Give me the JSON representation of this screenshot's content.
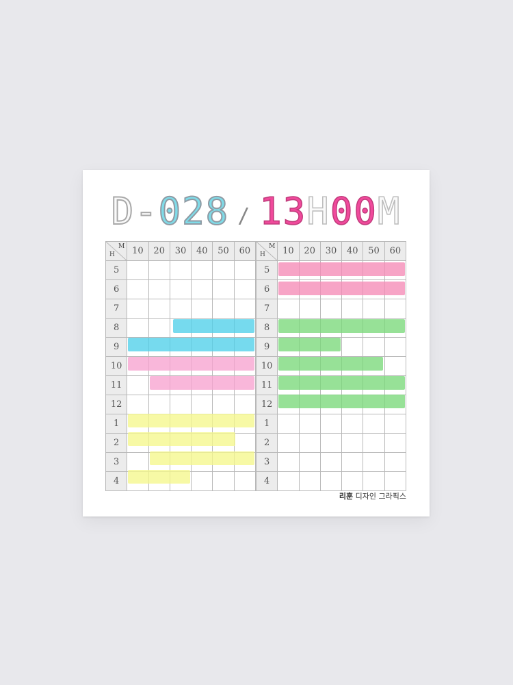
{
  "header": {
    "dday_prefix": "D-",
    "dday_digits": "028",
    "separator": "/",
    "time_hours": "13",
    "time_h_suffix": "H",
    "time_minutes": "00",
    "time_m_suffix": "M"
  },
  "corner": {
    "m_label": "M",
    "h_label": "H"
  },
  "minutes": [
    "10",
    "20",
    "30",
    "40",
    "50",
    "60"
  ],
  "left_hours": [
    "5",
    "6",
    "7",
    "8",
    "9",
    "10",
    "11",
    "12",
    "1",
    "2",
    "3",
    "4"
  ],
  "right_hours": [
    "5",
    "6",
    "7",
    "8",
    "9",
    "10",
    "11",
    "12",
    "1",
    "2",
    "3",
    "4"
  ],
  "colors": {
    "cyan": "#4fd0e9",
    "pink": "#f7a3cf",
    "yellow": "#f5f78c",
    "green": "#7ad97a",
    "hot_pink": "#f58ab6",
    "noon_line": "#e88a8a"
  },
  "highlights": {
    "left": [
      {
        "hour_index": 3,
        "start": 0.35,
        "end": 1.0,
        "color": "cyan"
      },
      {
        "hour_index": 4,
        "start": 0.0,
        "end": 1.0,
        "color": "cyan"
      },
      {
        "hour_index": 5,
        "start": 0.0,
        "end": 1.0,
        "color": "pink"
      },
      {
        "hour_index": 6,
        "start": 0.17,
        "end": 1.0,
        "color": "pink"
      },
      {
        "hour_index": 8,
        "start": 0.0,
        "end": 1.0,
        "color": "yellow"
      },
      {
        "hour_index": 9,
        "start": 0.0,
        "end": 0.85,
        "color": "yellow"
      },
      {
        "hour_index": 10,
        "start": 0.17,
        "end": 1.0,
        "color": "yellow"
      },
      {
        "hour_index": 11,
        "start": 0.0,
        "end": 0.5,
        "color": "yellow"
      }
    ],
    "right": [
      {
        "hour_index": 0,
        "start": 0.0,
        "end": 1.0,
        "color": "hot_pink"
      },
      {
        "hour_index": 1,
        "start": 0.0,
        "end": 1.0,
        "color": "hot_pink"
      },
      {
        "hour_index": 3,
        "start": 0.0,
        "end": 1.0,
        "color": "green"
      },
      {
        "hour_index": 4,
        "start": 0.0,
        "end": 0.5,
        "color": "green"
      },
      {
        "hour_index": 5,
        "start": 0.0,
        "end": 0.83,
        "color": "green"
      },
      {
        "hour_index": 6,
        "start": 0.0,
        "end": 1.0,
        "color": "green"
      },
      {
        "hour_index": 7,
        "start": 0.0,
        "end": 1.0,
        "color": "green"
      }
    ]
  },
  "brand": {
    "bold": "리훈",
    "rest": "디자인 그라픽스"
  }
}
